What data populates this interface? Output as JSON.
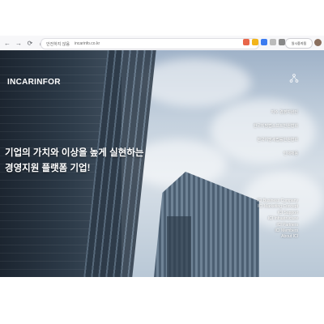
{
  "browser": {
    "security_label": "안전하지 않음",
    "url": "incarinfo.co.kr",
    "profile_label": "일시중지됨"
  },
  "site": {
    "logo": "INCARINFOR",
    "hero_line1": "기업의 가치와 이상을 높게 실현하는",
    "hero_line2": "경영지원 플랫폼 기업!",
    "ko_menu": [
      "지수 경영지원인",
      "한국지방법소프트민원협회",
      "한국지방세법률민원협회",
      "인재채용"
    ],
    "en_menu": [
      "ICI Business Company",
      "ICI Marketing Concept",
      "ICI Support",
      "ICI Infrastructure",
      "ICI Partners",
      "ICI Members",
      "About ICI"
    ]
  },
  "colors": {
    "toolbar_bg": "#f7f7f9",
    "text_on_image": "#ffffff"
  },
  "icons": [
    "back-arrow-icon",
    "forward-arrow-icon",
    "reload-icon",
    "home-icon",
    "menu-dots-icon"
  ]
}
